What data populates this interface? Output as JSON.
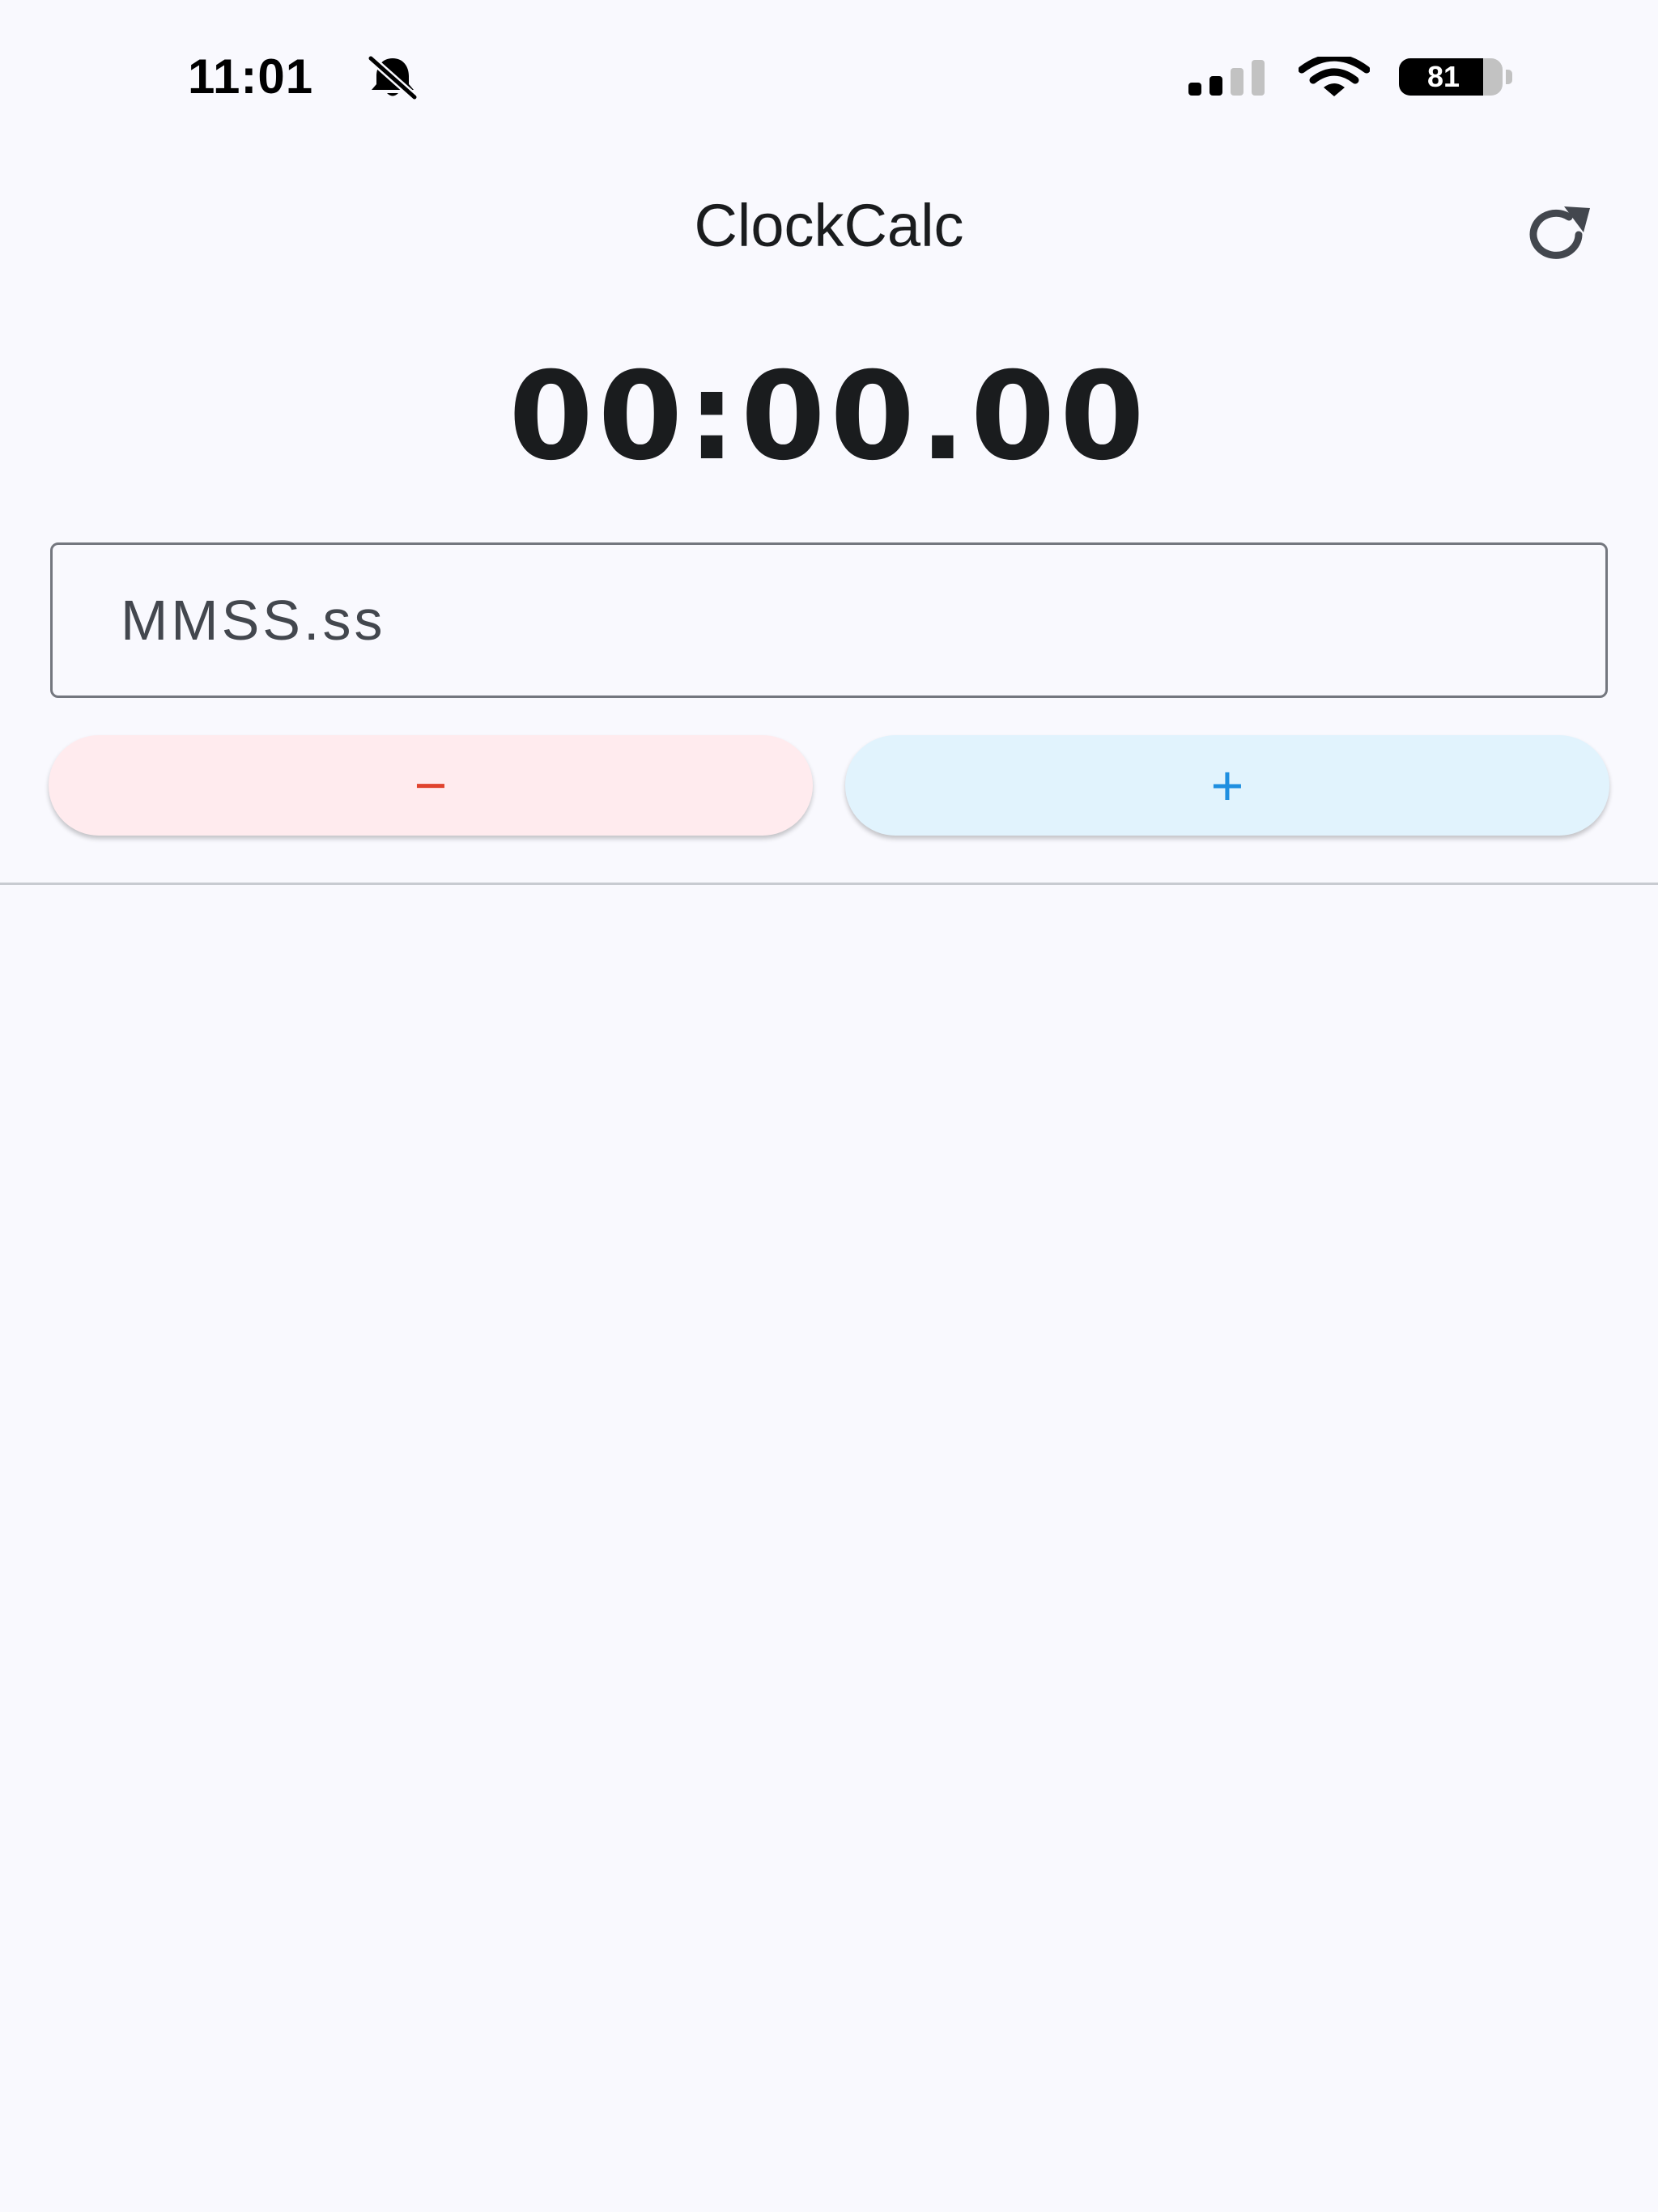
{
  "status_bar": {
    "time": "11:01",
    "battery_level": "81",
    "battery_fraction": 0.81,
    "icons": [
      "silent-bell-icon",
      "cellular-signal-icon",
      "wifi-icon",
      "battery-icon"
    ]
  },
  "app_bar": {
    "title": "ClockCalc",
    "refresh_icon": "refresh-icon"
  },
  "display": {
    "time": "00:00.00"
  },
  "input": {
    "placeholder": "MMSS.ss",
    "value": ""
  },
  "buttons": {
    "subtract_label": "−",
    "add_label": "+"
  },
  "colors": {
    "background": "#f9f9fe",
    "subtract_bg": "#ffebee",
    "subtract_fg": "#e0432e",
    "add_bg": "#e1f3fd",
    "add_fg": "#1f8fe0"
  }
}
